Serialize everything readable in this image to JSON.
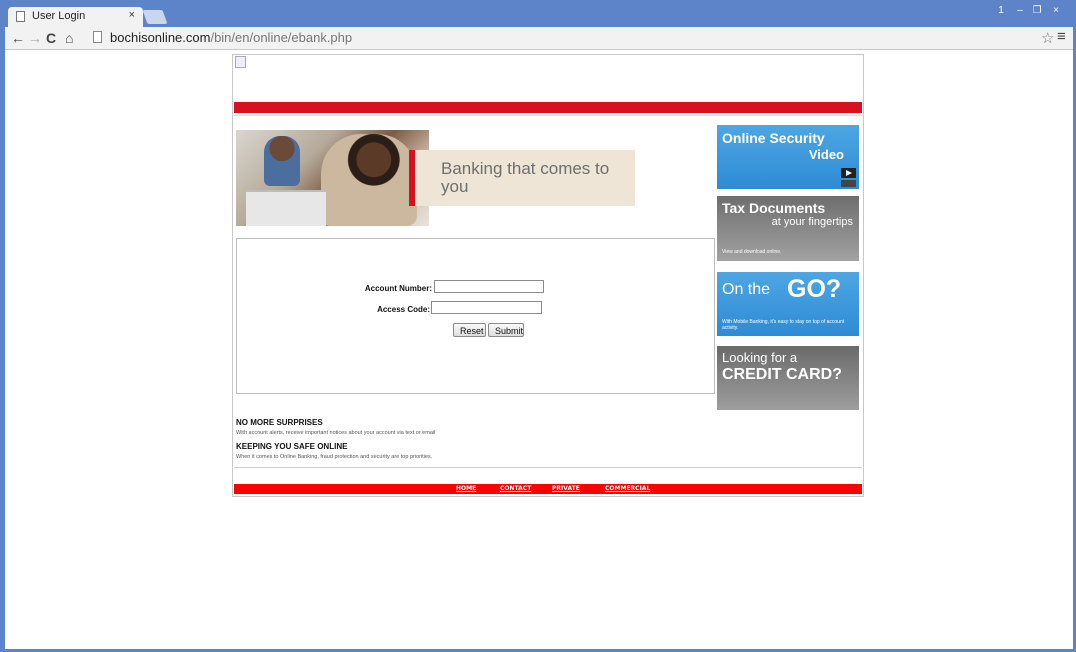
{
  "browser": {
    "tab_title": "User Login",
    "tab_close": "×",
    "url_domain": "bochisonline.com",
    "url_path": "/bin/en/online/ebank.php",
    "window_controls": [
      "1",
      "–",
      "❐",
      "×"
    ]
  },
  "header": {
    "logo_alt": ""
  },
  "hero": {
    "text": "Banking that comes to you"
  },
  "login": {
    "account_label": "Account Number:",
    "access_label": "Access Code:",
    "account_value": "",
    "access_value": "",
    "reset_label": "Reset",
    "submit_label": "Submit"
  },
  "promos": {
    "security": {
      "line1": "Online Security",
      "line2": "Video"
    },
    "tax": {
      "line1": "Tax Documents",
      "line2": "at your fingertips",
      "small": "View and download online."
    },
    "go": {
      "line1": "On the",
      "line2": "GO?",
      "small": "With Mobile Banking, it's easy to stay on top of account activity."
    },
    "credit": {
      "line1": "Looking for a",
      "line2": "CREDIT CARD?"
    }
  },
  "notices": [
    {
      "title": "NO MORE SURPRISES",
      "body": "With account alerts, receive important notices about your account via text or email"
    },
    {
      "title": "KEEPING YOU SAFE ONLINE",
      "body": "When it comes to Online Banking, fraud protection and security are top priorities."
    }
  ],
  "footer": {
    "links": [
      "HOME",
      "CONTACT",
      "PRIVATE",
      "COMMERCIAL"
    ]
  },
  "colors": {
    "brand_red": "#d8111e",
    "footer_red": "#ff0000",
    "promo_blue": "#2e8bd4",
    "promo_gray": "#8a8a8a",
    "chrome_blue": "#5d83c9"
  }
}
